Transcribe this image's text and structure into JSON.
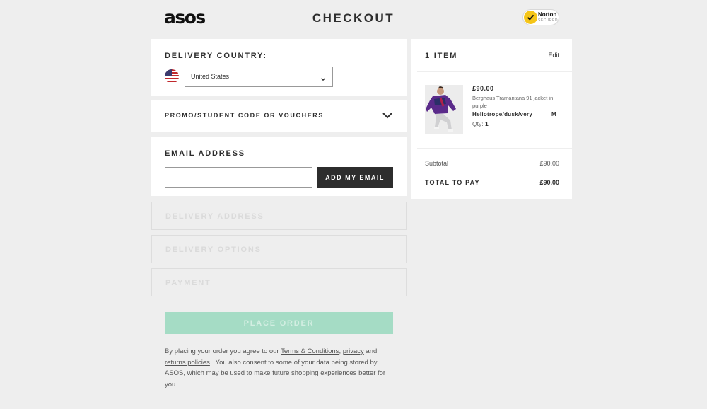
{
  "header": {
    "logo": "asos",
    "title": "CHECKOUT",
    "badge": {
      "brand": "Norton",
      "subtext": "SECURED"
    }
  },
  "delivery_country": {
    "label": "DELIVERY COUNTRY:",
    "flag_icon": "us-flag-icon",
    "selected": "United States"
  },
  "promo": {
    "label": "PROMO/STUDENT CODE OR VOUCHERS",
    "icon": "chevron-down-icon"
  },
  "email": {
    "label": "EMAIL ADDRESS",
    "value": "",
    "placeholder": "",
    "button_label": "ADD MY EMAIL"
  },
  "disabled_sections": {
    "delivery_address": "DELIVERY ADDRESS",
    "delivery_options": "DELIVERY OPTIONS",
    "payment": "PAYMENT"
  },
  "place_order": {
    "label": "PLACE ORDER"
  },
  "terms": {
    "part1": "By placing your order you agree to our ",
    "link_terms": "Terms & Conditions",
    "sep1": ", ",
    "link_privacy": "privacy",
    "part2": " and ",
    "link_returns": "returns policies",
    "part3": " . You also consent to some of your data being stored by ASOS, which may be used to make future shopping experiences better for you."
  },
  "summary": {
    "title": "1 ITEM",
    "edit_label": "Edit",
    "item": {
      "price": "£90.00",
      "name": "Berghaus Tramantana 91 jacket in purple",
      "color": "Heliotrope/dusk/very",
      "size": "M",
      "qty_label": "Qty:",
      "qty": "1"
    },
    "subtotal_label": "Subtotal",
    "subtotal_value": "£90.00",
    "total_label": "TOTAL TO PAY",
    "total_value": "£90.00"
  },
  "colors": {
    "background": "#eeeeee",
    "dark": "#2d2d2d",
    "place_order_disabled": "#a5dcc5"
  }
}
